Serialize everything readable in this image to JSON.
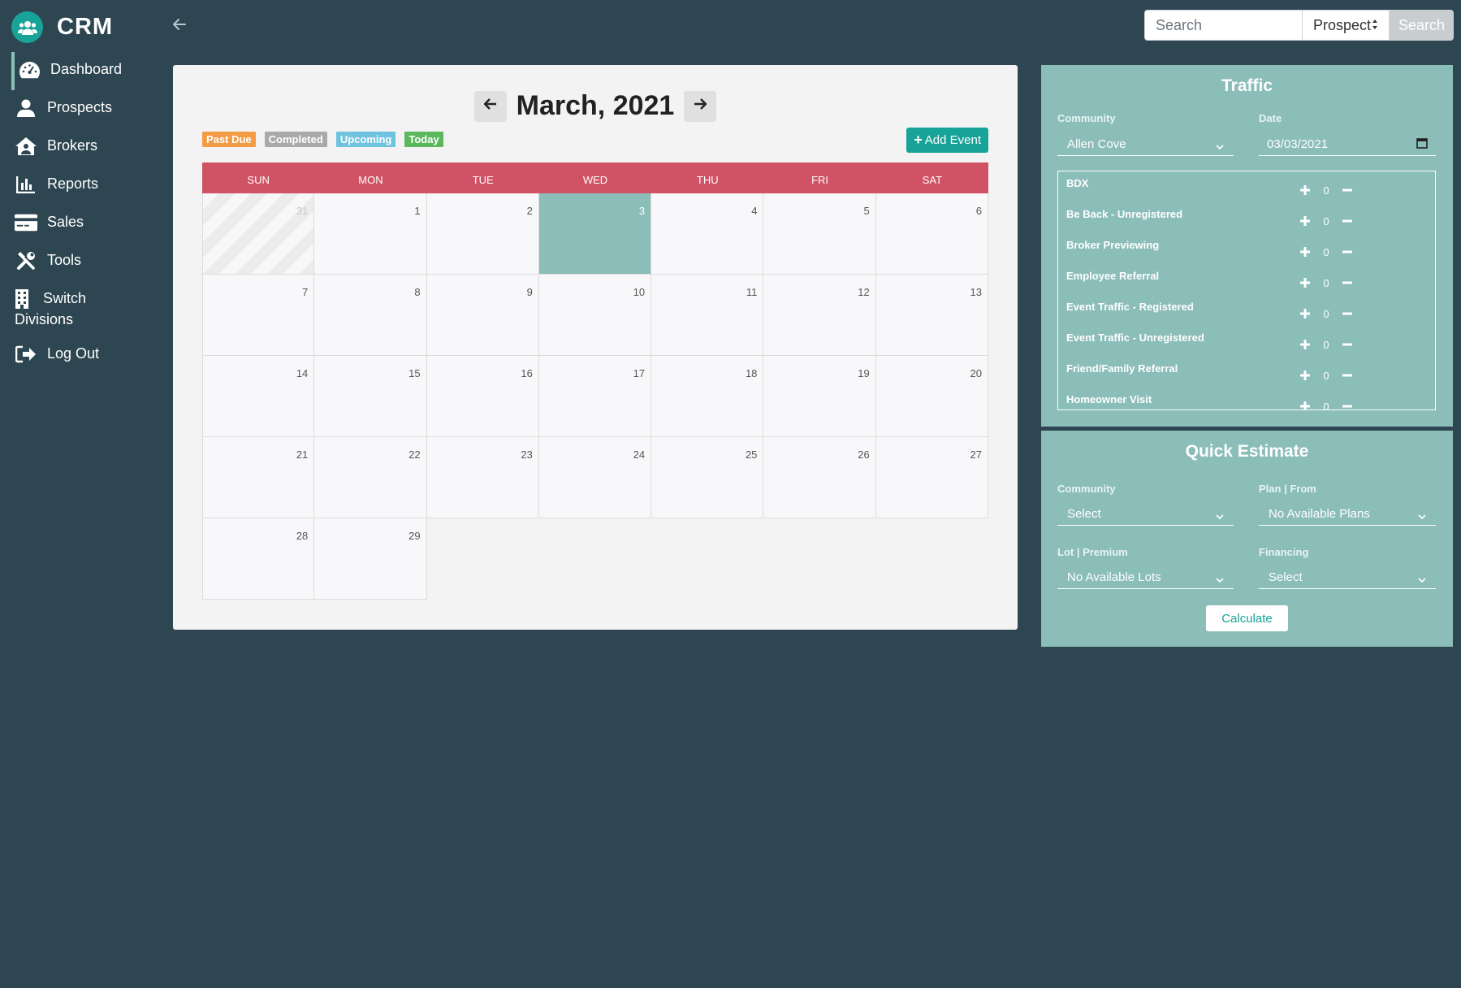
{
  "brand": {
    "name": "CRM",
    "logo_icon": "users-icon"
  },
  "nav": [
    {
      "label": "Dashboard",
      "icon": "dashboard-icon",
      "active": true
    },
    {
      "label": "Prospects",
      "icon": "user-icon"
    },
    {
      "label": "Brokers",
      "icon": "house-user-icon"
    },
    {
      "label": "Reports",
      "icon": "bar-chart-icon"
    },
    {
      "label": "Sales",
      "icon": "credit-card-icon"
    },
    {
      "label": "Tools",
      "icon": "tools-icon"
    },
    {
      "label": "Switch",
      "label2": "Divisions",
      "icon": "building-icon"
    },
    {
      "label": "Log Out",
      "icon": "sign-out-icon"
    }
  ],
  "search": {
    "placeholder": "Search",
    "type_selected": "Prospect",
    "button": "Search"
  },
  "calendar": {
    "title": "March, 2021",
    "legend": {
      "past_due": "Past Due",
      "completed": "Completed",
      "upcoming": "Upcoming",
      "today": "Today"
    },
    "add_event": "Add Event",
    "dow": [
      "SUN",
      "MON",
      "TUE",
      "WED",
      "THU",
      "FRI",
      "SAT"
    ],
    "days": [
      "31",
      "1",
      "2",
      "3",
      "4",
      "5",
      "6",
      "7",
      "8",
      "9",
      "10",
      "11",
      "12",
      "13",
      "14",
      "15",
      "16",
      "17",
      "18",
      "19",
      "20",
      "21",
      "22",
      "23",
      "24",
      "25",
      "26",
      "27",
      "28",
      "29"
    ],
    "today": "3",
    "other_month": [
      "31"
    ]
  },
  "traffic": {
    "title": "Traffic",
    "community_label": "Community",
    "community_value": "Allen Cove",
    "date_label": "Date",
    "date_value": "03/03/2021",
    "rows": [
      {
        "label": "BDX",
        "count": "0"
      },
      {
        "label": "Be Back - Unregistered",
        "count": "0"
      },
      {
        "label": "Broker Previewing",
        "count": "0"
      },
      {
        "label": "Employee Referral",
        "count": "0"
      },
      {
        "label": "Event Traffic - Registered",
        "count": "0"
      },
      {
        "label": "Event Traffic - Unregistered",
        "count": "0"
      },
      {
        "label": "Friend/Family Referral",
        "count": "0"
      },
      {
        "label": "Homeowner Visit",
        "count": "0"
      }
    ]
  },
  "quick_estimate": {
    "title": "Quick Estimate",
    "community_label": "Community",
    "community_value": "Select",
    "plan_label": "Plan | From",
    "plan_value": "No Available Plans",
    "lot_label": "Lot | Premium",
    "lot_value": "No Available Lots",
    "financing_label": "Financing",
    "financing_value": "Select",
    "calculate": "Calculate"
  }
}
